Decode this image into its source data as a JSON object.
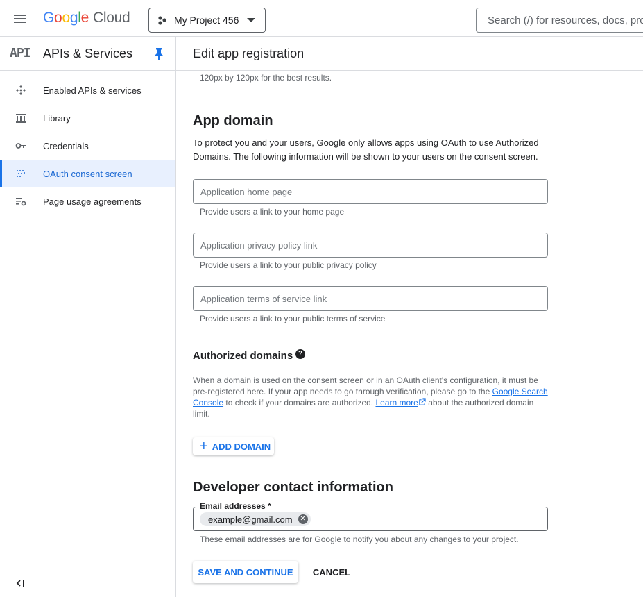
{
  "topbar": {
    "brand": {
      "g1": "G",
      "g2": "o",
      "g3": "o",
      "g4": "g",
      "g5": "l",
      "g6": "e",
      "cloud": "Cloud"
    },
    "project_name": "My Project 456",
    "search_placeholder": "Search (/) for resources, docs, products, and more"
  },
  "sidebar": {
    "badge": "API",
    "title": "APIs & Services",
    "items": [
      {
        "label": "Enabled APIs & services",
        "icon": "enabled-apis-icon",
        "active": false
      },
      {
        "label": "Library",
        "icon": "library-icon",
        "active": false
      },
      {
        "label": "Credentials",
        "icon": "key-icon",
        "active": false
      },
      {
        "label": "OAuth consent screen",
        "icon": "oauth-dots-icon",
        "active": true
      },
      {
        "label": "Page usage agreements",
        "icon": "settings-list-icon",
        "active": false
      }
    ]
  },
  "main": {
    "title": "Edit app registration",
    "logo_note": "120px by 120px for the best results.",
    "app_domain": {
      "heading": "App domain",
      "description": "To protect you and your users, Google only allows apps using OAuth to use Authorized Domains. The following information will be shown to your users on the consent screen.",
      "home_page": {
        "placeholder": "Application home page",
        "hint": "Provide users a link to your home page"
      },
      "privacy": {
        "placeholder": "Application privacy policy link",
        "hint": "Provide users a link to your public privacy policy"
      },
      "terms": {
        "placeholder": "Application terms of service link",
        "hint": "Provide users a link to your public terms of service"
      }
    },
    "authorized_domains": {
      "heading": "Authorized domains",
      "desc_1": "When a domain is used on the consent screen or in an OAuth client's configuration, it must be pre-registered here. If your app needs to go through verification, please go to the ",
      "link_search_console": "Google Search Console",
      "desc_2": " to check if your domains are authorized. ",
      "link_learn_more": "Learn more",
      "desc_3": " about the authorized domain limit.",
      "add_label": "ADD DOMAIN"
    },
    "developer": {
      "heading": "Developer contact information",
      "email_label": "Email addresses *",
      "email_chip": "example@gmail.com",
      "hint": "These email addresses are for Google to notify you about any changes to your project."
    },
    "actions": {
      "save": "SAVE AND CONTINUE",
      "cancel": "CANCEL"
    }
  },
  "colors": {
    "accent": "#1a73e8",
    "active_bg": "#e8f0fe",
    "border": "#dadce0"
  }
}
